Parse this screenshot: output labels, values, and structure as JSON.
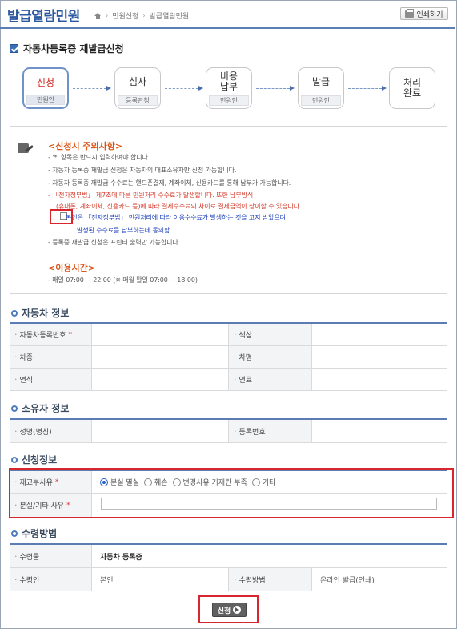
{
  "header": {
    "title": "발급열람민원",
    "breadcrumb": [
      "민원신청",
      "발급열람민원"
    ],
    "print_label": "인쇄하기"
  },
  "page_title": "자동차등록증 재발급신청",
  "steps": [
    {
      "label": "신청",
      "sub": "민원인"
    },
    {
      "label": "심사",
      "sub": "등록관청"
    },
    {
      "label": "비용\n납부",
      "sub": "민원인"
    },
    {
      "label": "발급",
      "sub": "민원인"
    },
    {
      "label": "처리\n완료",
      "sub": ""
    }
  ],
  "notice": {
    "title1": "<신청시 주의사항>",
    "lines": [
      "- '*' 항목은 반드시 입력하여야 합니다.",
      "- 자동차 등록증 재발급 신청은 자동차의 대표소유자만 신청 가능합니다.",
      "- 자동차 등록증 재발급 수수료는 핸드폰결제, 계좌이체, 신용카드를 통해 납부가 가능합니다.",
      "- 「전자정부법」 제7조에 따른 민원처리 수수료가 발생합니다. 또한 납부방식",
      "(휴대폰, 계좌이체, 신용카드 등)에 따라 결제수수료의 차이로 결제금액이 상이할 수 있습니다.",
      "본인은 「전자정부법」 민원처리에 따라 이용수수료가 발생하는 것을 고지 받았으며",
      "발생된 수수료를 납부하는데 동의함.",
      "- 등록증 재발급 신청은 프린터 출력만 가능합니다."
    ],
    "title2": "<이용시간>",
    "hours": "- 매일 07:00 ~ 22:00 (※ 매월 말일 07:00 ~ 18:00)"
  },
  "car_info": {
    "title": "자동차 정보",
    "reg_no_label": "자동차등록번호",
    "color_label": "색상",
    "type_label": "차종",
    "name_label": "차명",
    "year_label": "연식",
    "fuel_label": "연료"
  },
  "owner_info": {
    "title": "소유자 정보",
    "name_label": "성명(명칭)",
    "reg_label": "등록번호"
  },
  "apply_info": {
    "title": "신청정보",
    "reason_label": "재교부사유",
    "reasons": [
      "분실 멸실",
      "훼손",
      "변경사유 기재란 부족",
      "기타"
    ],
    "selected_reason": "분실 멸실",
    "detail_label": "분실/기타 사유",
    "detail_value": ""
  },
  "receive_info": {
    "title": "수령방법",
    "item_label": "수령물",
    "item_value": "자동차 등록증",
    "person_label": "수령인",
    "person_value": "본인",
    "method_label": "수령방법",
    "method_value": "온라인 발급(인쇄)"
  },
  "submit_label": "신청"
}
